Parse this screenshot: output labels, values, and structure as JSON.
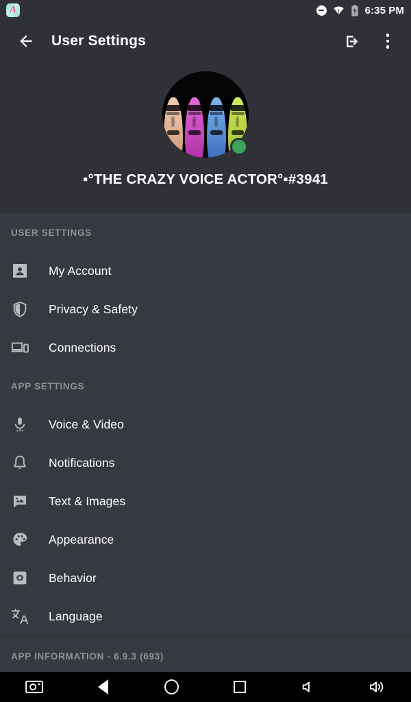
{
  "status_bar": {
    "app_icon": "app-notification-icon",
    "app_icon_glyph": "A",
    "dnd_icon": "do-not-disturb-icon",
    "wifi_icon": "wifi-warning-icon",
    "battery_icon": "battery-charging-icon",
    "time": "6:35 PM"
  },
  "app_bar": {
    "back_icon": "back-arrow-icon",
    "title": "User Settings",
    "logout_icon": "logout-icon",
    "overflow_icon": "overflow-menu-icon"
  },
  "profile": {
    "avatar_icon": "user-avatar",
    "status": "online",
    "status_color": "#3ba55c",
    "username": "▪°THE CRAZY VOICE ACTOR°▪#3941",
    "avatar_face_colors": [
      "#e8b79a",
      "#d54fc4",
      "#4f8fe0",
      "#bcd64a"
    ]
  },
  "sections": [
    {
      "header": "USER SETTINGS",
      "items": [
        {
          "label": "My Account",
          "icon": "account-box-icon"
        },
        {
          "label": "Privacy & Safety",
          "icon": "shield-icon"
        },
        {
          "label": "Connections",
          "icon": "devices-icon"
        }
      ]
    },
    {
      "header": "APP SETTINGS",
      "items": [
        {
          "label": "Voice & Video",
          "icon": "microphone-icon"
        },
        {
          "label": "Notifications",
          "icon": "bell-icon"
        },
        {
          "label": "Text & Images",
          "icon": "chat-image-icon"
        },
        {
          "label": "Appearance",
          "icon": "palette-icon"
        },
        {
          "label": "Behavior",
          "icon": "gear-box-icon"
        },
        {
          "label": "Language",
          "icon": "translate-icon"
        }
      ]
    }
  ],
  "app_information": {
    "label": "APP INFORMATION - 6.9.3 (693)"
  },
  "nav_bar": {
    "items": [
      {
        "icon": "screenshot-icon",
        "label": "Screenshot"
      },
      {
        "icon": "back-triangle-icon",
        "label": "Back"
      },
      {
        "icon": "home-circle-icon",
        "label": "Home"
      },
      {
        "icon": "recents-square-icon",
        "label": "Recents"
      },
      {
        "icon": "volume-down-icon",
        "label": "Volume Down"
      },
      {
        "icon": "volume-up-icon",
        "label": "Volume Up"
      }
    ]
  },
  "colors": {
    "header_bg": "#2f3136",
    "list_bg": "#36393f",
    "text_primary": "#ffffff",
    "text_muted": "#8e9297",
    "icon": "#b9bbbe",
    "online": "#3ba55c"
  }
}
